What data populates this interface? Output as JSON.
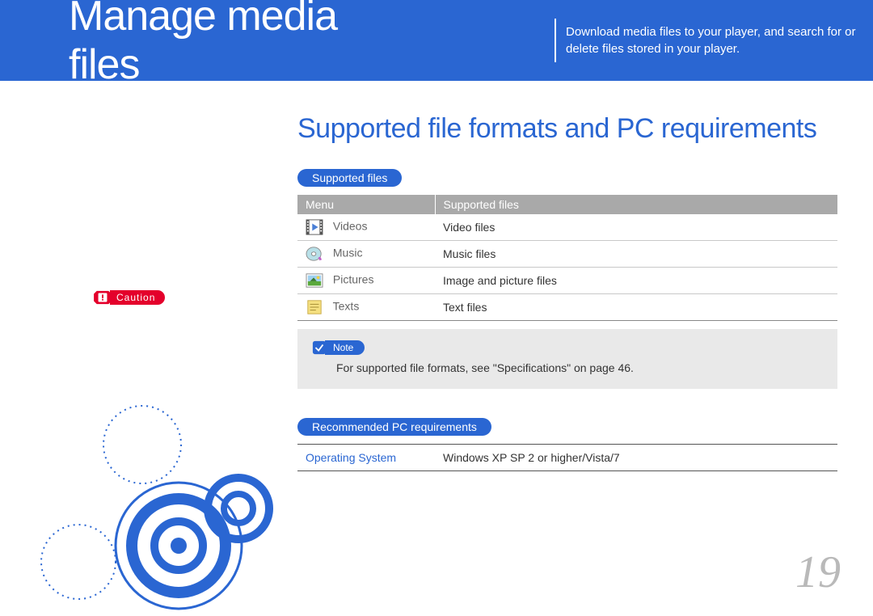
{
  "header": {
    "title": "Manage media files",
    "description": "Download media files to your player, and search for or delete files stored in your player."
  },
  "main": {
    "section_title": "Supported file formats and PC requirements",
    "supported_files_label": "Supported files",
    "table": {
      "col_menu": "Menu",
      "col_supported": "Supported files",
      "rows": [
        {
          "menu": "Videos",
          "supported": "Video files",
          "icon": "video"
        },
        {
          "menu": "Music",
          "supported": "Music files",
          "icon": "music"
        },
        {
          "menu": "Pictures",
          "supported": "Image and picture files",
          "icon": "picture"
        },
        {
          "menu": "Texts",
          "supported": "Text files",
          "icon": "text"
        }
      ]
    },
    "note": {
      "label": "Note",
      "text": "For supported file formats, see \"Specifications\" on page 46."
    },
    "pc_req_label": "Recommended PC requirements",
    "pc_table": {
      "os_label": "Operating System",
      "os_value": "Windows XP SP 2 or higher/Vista/7"
    }
  },
  "caution_label": "Caution",
  "page_number": "19"
}
